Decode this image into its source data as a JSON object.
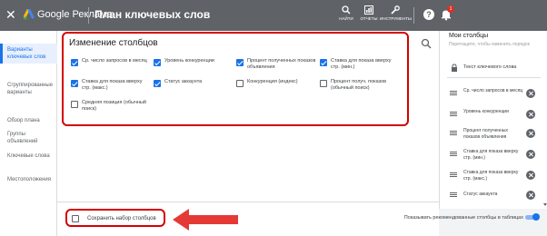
{
  "header": {
    "brand": "Google Реклама",
    "title": "План ключевых слов",
    "tools": [
      {
        "label": "Отчеты",
        "icon": "chart-icon"
      },
      {
        "label": "Инструменты",
        "icon": "wrench-icon"
      }
    ],
    "search_label": "Найти",
    "notification_count": "1",
    "colors": {
      "bar": "#5f6368",
      "badge": "#d93025"
    }
  },
  "sidebar": {
    "items": [
      {
        "label": "Варианты ключевых слов",
        "active": true
      },
      {
        "label": "Сгруппированные варианты",
        "active": false
      },
      {
        "label": "Обзор плана",
        "active": false
      },
      {
        "label": "Группы объявлений",
        "active": false
      },
      {
        "label": "Ключевые слова",
        "active": false
      },
      {
        "label": "Местоположения",
        "active": false
      }
    ]
  },
  "dialog": {
    "title": "Изменение столбцов",
    "options": [
      {
        "label": "Ср. число запросов в месяц",
        "checked": true
      },
      {
        "label": "Уровень конкуренции",
        "checked": true
      },
      {
        "label": "Процент полученных показов объявления",
        "checked": true
      },
      {
        "label": "Ставка для показа вверху стр. (мин.)",
        "checked": true
      },
      {
        "label": "Ставка для показа вверху стр. (макс.)",
        "checked": true
      },
      {
        "label": "Статус аккаунта",
        "checked": true
      },
      {
        "label": "Конкуренция (индекс)",
        "checked": false
      },
      {
        "label": "Процент получ. показов (обычный поиск)",
        "checked": false
      },
      {
        "label": "Средняя позиция (обычный поиск)",
        "checked": false
      }
    ],
    "save_set_label": "Сохранить набор столбцов",
    "save_set_checked": false,
    "recommended_label": "Показывать рекомендованные столбцы в таблицах",
    "recommended_on": true,
    "accent": "#1a73e8"
  },
  "my_columns": {
    "title": "Мои столбцы",
    "hint": "Перетащите, чтобы изменить порядок",
    "fixed": "Текст ключевого слова",
    "items": [
      "Ср. число запросов в месяц",
      "Уровень конкуренции",
      "Процент полученных показов объявления",
      "Ставка для показа вверху стр. (мин.)",
      "Ставка для показа вверху стр. (макс.)",
      "Статус аккаунта"
    ]
  },
  "annotation": {
    "color": "#d50000"
  }
}
